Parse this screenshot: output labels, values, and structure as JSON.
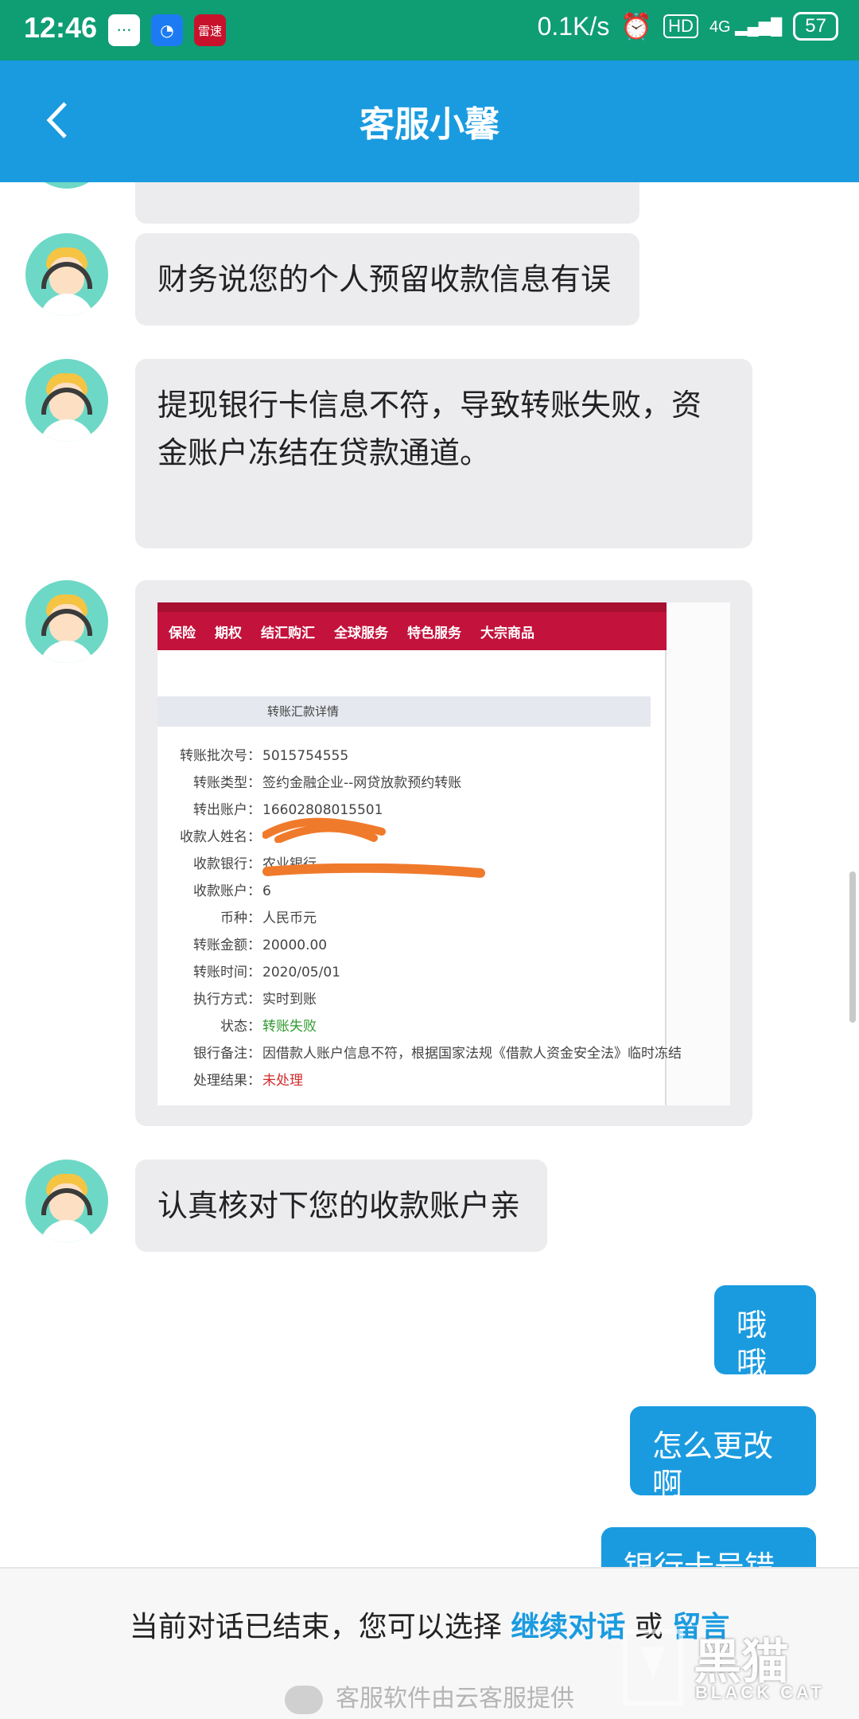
{
  "status_bar": {
    "time": "12:46",
    "network_speed": "0.1K/s",
    "hd": "HD",
    "signal": "4G",
    "battery": "57",
    "app_icon_red_label": "雷速"
  },
  "header": {
    "title": "客服小馨",
    "back_icon": "chevron-left-icon",
    "color": "#1a9be0"
  },
  "messages": [
    {
      "side": "left",
      "text": "财务说您的个人预留收款信息有误"
    },
    {
      "side": "left",
      "text": "提现银行卡信息不符，导致转账失败，资金账户冻结在贷款通道。"
    },
    {
      "side": "left",
      "type": "image"
    },
    {
      "side": "left",
      "text": "认真核对下您的收款账户亲"
    },
    {
      "side": "right",
      "text": "哦哦"
    },
    {
      "side": "right",
      "text": "怎么更改啊"
    },
    {
      "side": "right",
      "text": "银行卡号错了"
    }
  ],
  "screenshot": {
    "nav": [
      "保险",
      "期权",
      "结汇购汇",
      "全球服务",
      "特色服务",
      "大宗商品"
    ],
    "panel_title": "转账汇款详情",
    "rows": [
      {
        "key": "转账批次号：",
        "value": "5015754555"
      },
      {
        "key": "转账类型：",
        "value": "签约金融企业--网贷放款预约转账"
      },
      {
        "key": "转出账户：",
        "value": "16602808015501"
      },
      {
        "key": "收款人姓名：",
        "value": ""
      },
      {
        "key": "收款银行：",
        "value": "农业银行"
      },
      {
        "key": "收款账户：",
        "value": "6"
      },
      {
        "key": "币种：",
        "value": "人民币元"
      },
      {
        "key": "转账金额：",
        "value": "20000.00"
      },
      {
        "key": "转账时间：",
        "value": "2020/05/01"
      },
      {
        "key": "执行方式：",
        "value": "实时到账"
      },
      {
        "key": "状态：",
        "value": "转账失败"
      },
      {
        "key": "银行备注：",
        "value": "因借款人账户信息不符，根据国家法规《借款人资金安全法》临时冻结"
      },
      {
        "key": "处理结果：",
        "value": "未处理"
      }
    ],
    "status_color": "#2f9a2f",
    "result_color": "#d22c2c"
  },
  "footer": {
    "ended_text": "当前对话已结束，您可以选择",
    "continue_link": "继续对话",
    "or_text": "或",
    "leave_msg_link": "留言",
    "provider_text": "客服软件由云客服提供"
  },
  "watermark": {
    "main": "黑猫",
    "sub": "BLACK CAT"
  }
}
